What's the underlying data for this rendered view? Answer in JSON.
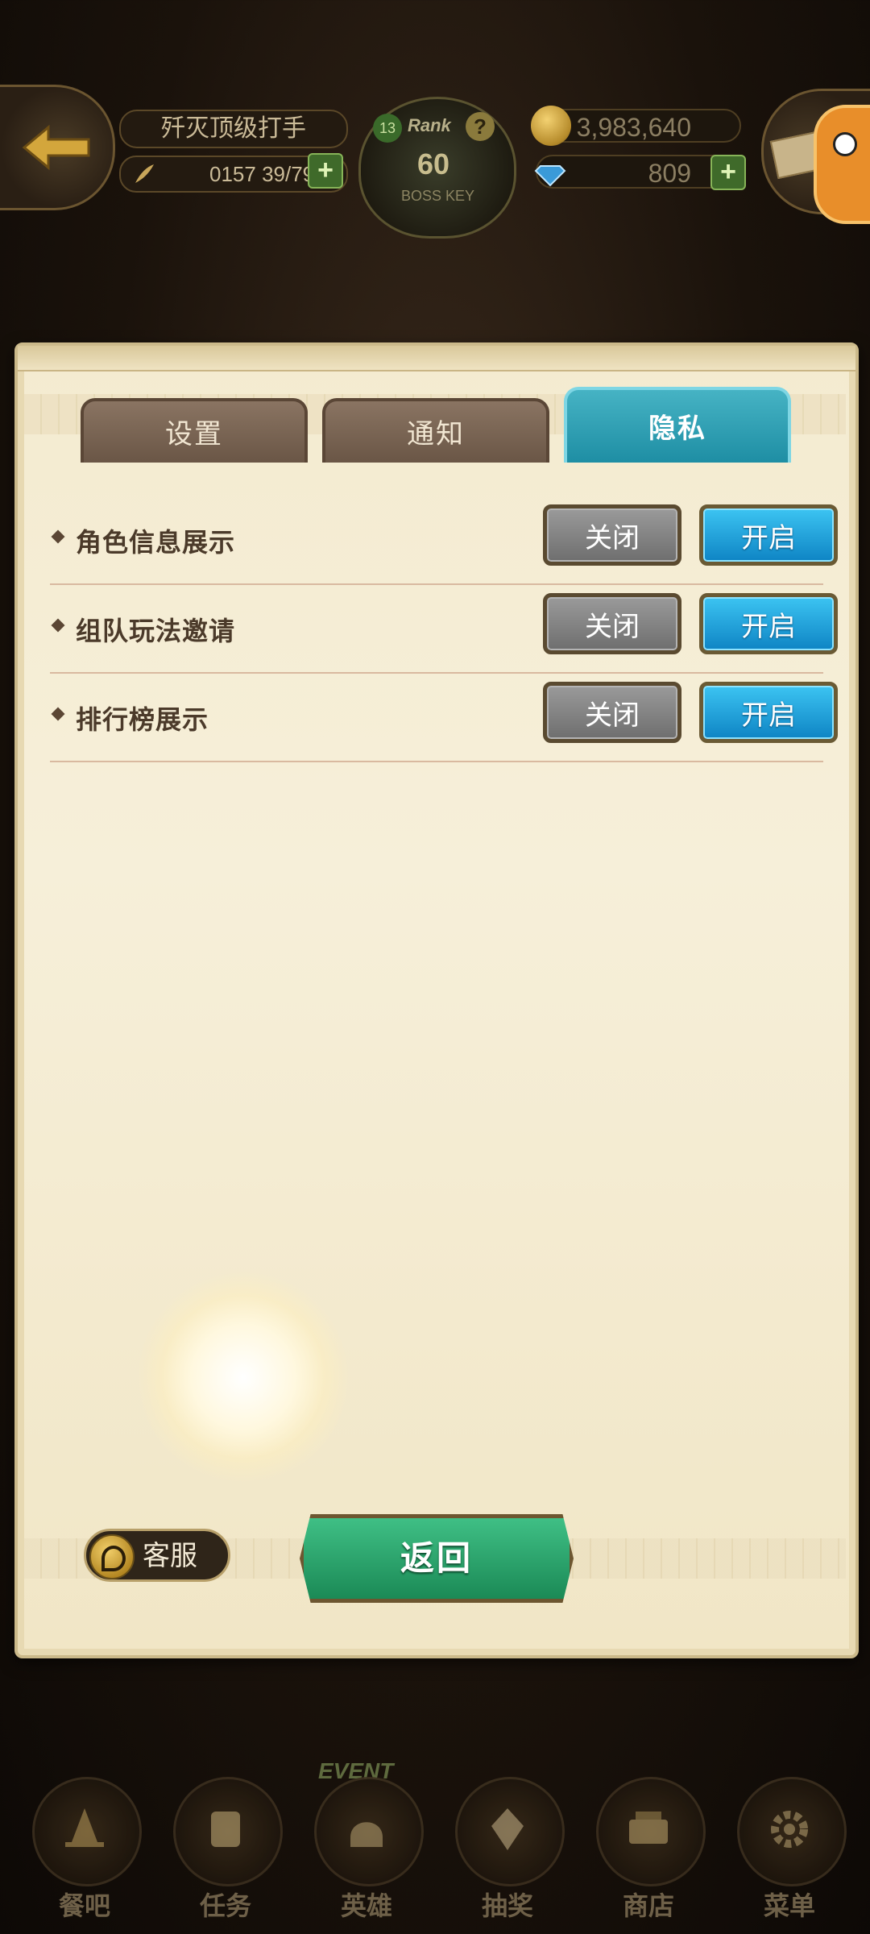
{
  "hud": {
    "player_name": "歼灭顶级打手",
    "stamina": "0157 39/79",
    "rank_label": "Rank",
    "rank_level": "60",
    "rank_sub": "BOSS KEY",
    "rank_small_level": "13",
    "gold": "3,983,640",
    "gems": "809"
  },
  "tabs": [
    {
      "label": "设置",
      "active": false
    },
    {
      "label": "通知",
      "active": false
    },
    {
      "label": "隐私",
      "active": true
    }
  ],
  "rows": [
    {
      "label": "角色信息展示",
      "off": "关闭",
      "on": "开启"
    },
    {
      "label": "组队玩法邀请",
      "off": "关闭",
      "on": "开启"
    },
    {
      "label": "排行榜展示",
      "off": "关闭",
      "on": "开启"
    }
  ],
  "footer": {
    "customer_service": "客服",
    "return": "返回"
  },
  "bottom_nav": {
    "event_tag": "EVENT",
    "items": [
      {
        "label": "餐吧",
        "icon": "witch-hat-icon"
      },
      {
        "label": "任务",
        "icon": "scroll-icon"
      },
      {
        "label": "英雄",
        "icon": "helmet-icon"
      },
      {
        "label": "抽奖",
        "icon": "crystal-icon"
      },
      {
        "label": "商店",
        "icon": "shop-icon"
      },
      {
        "label": "菜单",
        "icon": "gear-icon"
      }
    ]
  },
  "colors": {
    "tab_active": "#1e8ea4",
    "toggle_on": "#0e84c4",
    "toggle_off": "#6e6e6e",
    "return_button": "#1b8a56"
  }
}
